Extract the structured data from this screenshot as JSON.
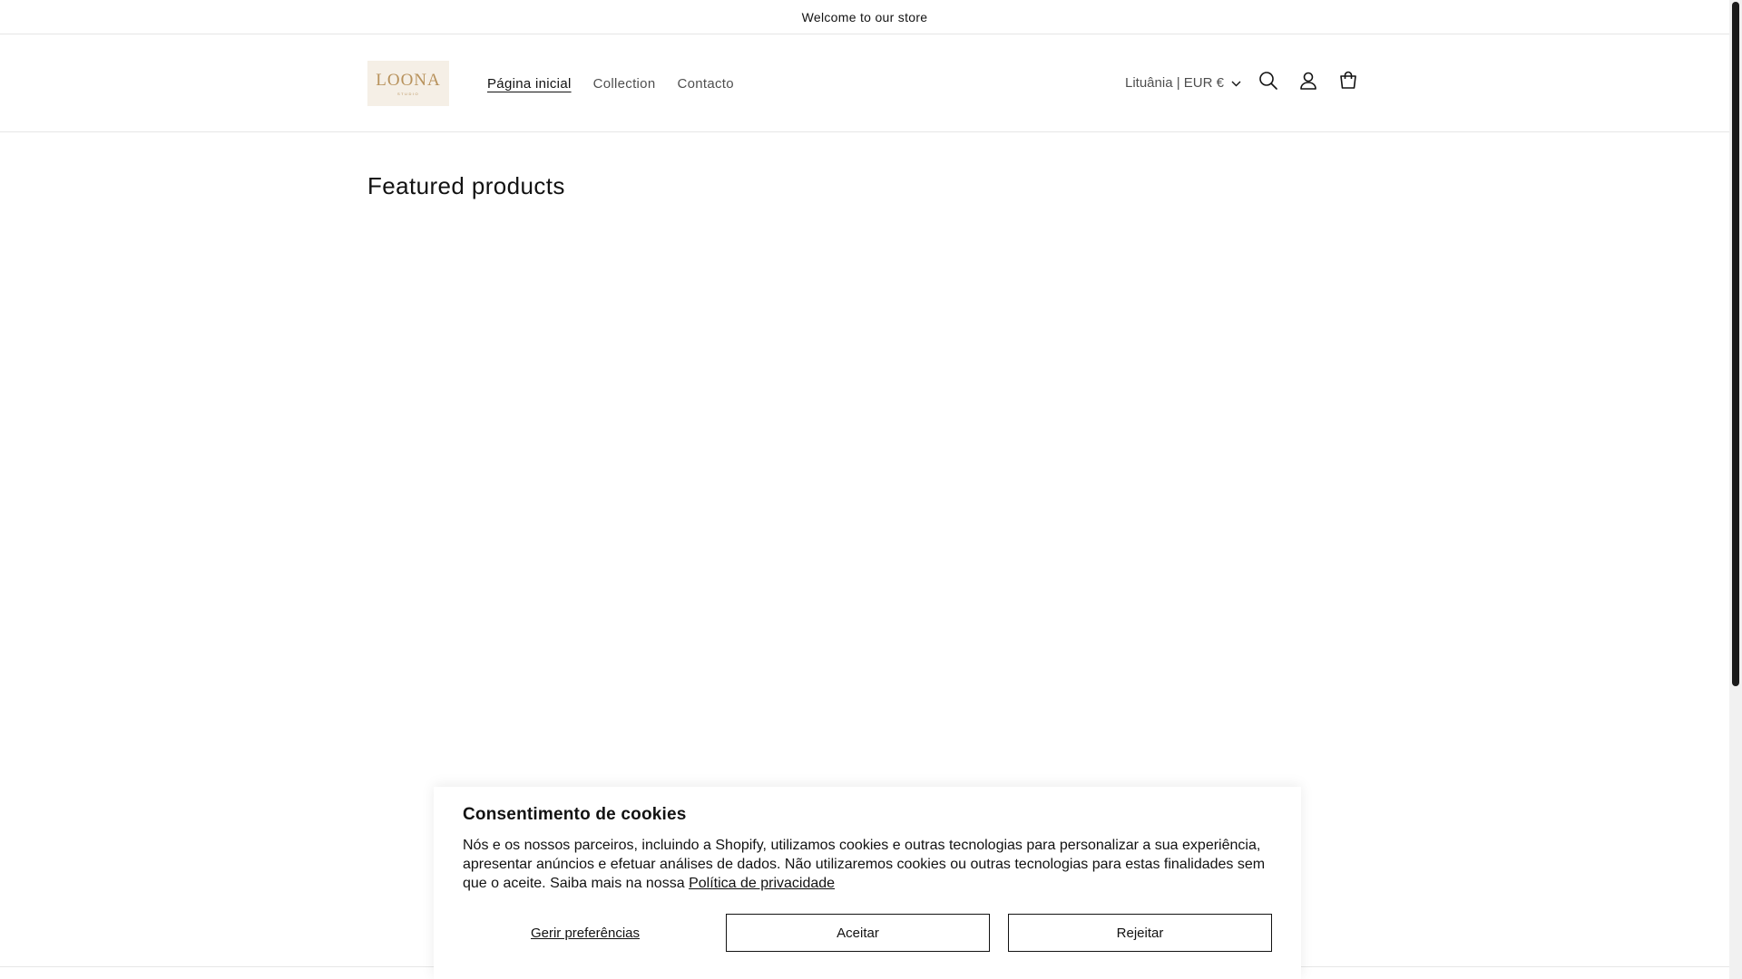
{
  "announcement": {
    "text": "Welcome to our store"
  },
  "header": {
    "logo": {
      "word": "LOONA",
      "sub": "STUDIO"
    },
    "nav": [
      {
        "label": "Página inicial",
        "active": true
      },
      {
        "label": "Collection",
        "active": false
      },
      {
        "label": "Contacto",
        "active": false
      }
    ],
    "localization": {
      "label": "Lituânia | EUR €"
    },
    "icons": {
      "search": "search-icon",
      "account": "account-icon",
      "cart": "cart-icon"
    }
  },
  "main": {
    "section_title": "Featured products"
  },
  "cookie_banner": {
    "title": "Consentimento de cookies",
    "body": "Nós e os nossos parceiros, incluindo a Shopify, utilizamos cookies e outras tecnologias para personalizar a sua experiência, apresentar anúncios e efetuar análises de dados. Não utilizaremos cookies ou outras tecnologias para estas finalidades sem que o aceite. Saiba mais na nossa",
    "policy_link": "Política de privacidade",
    "manage_label": "Gerir preferências",
    "accept_label": "Aceitar",
    "reject_label": "Rejeitar"
  },
  "colors": {
    "text": "#121212",
    "logo_bg": "#f5efe6",
    "logo_gold": "#b8925c",
    "divider": "#e6e6e6"
  }
}
